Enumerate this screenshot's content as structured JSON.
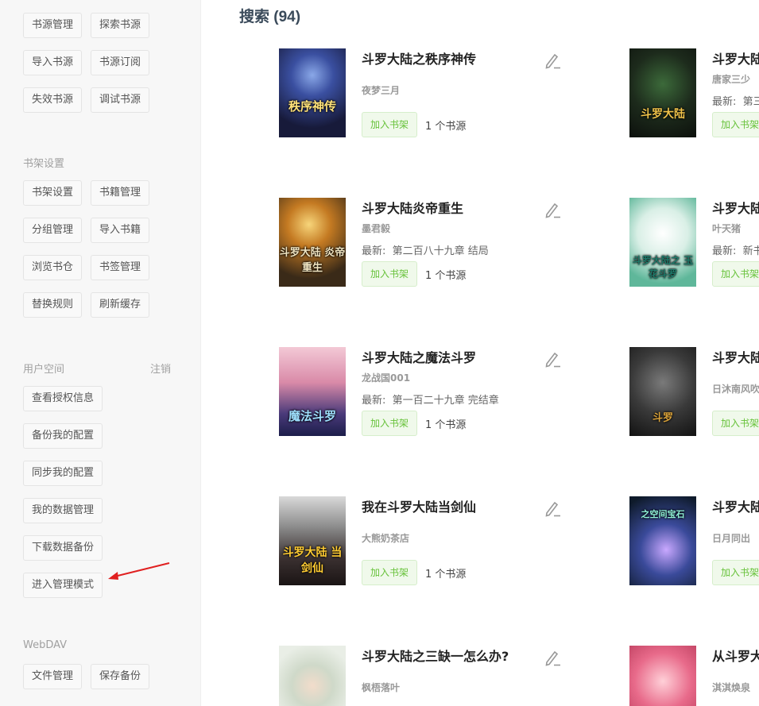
{
  "sidebar": {
    "source_buttons": [
      "书源管理",
      "探索书源",
      "导入书源",
      "书源订阅",
      "失效书源",
      "调试书源"
    ],
    "shelf_section": "书架设置",
    "shelf_buttons": [
      "书架设置",
      "书籍管理",
      "分组管理",
      "导入书籍",
      "浏览书仓",
      "书签管理",
      "替换规则",
      "刷新缓存"
    ],
    "user_section": "用户空间",
    "logout_label": "注销",
    "user_buttons": [
      "查看授权信息",
      "备份我的配置",
      "同步我的配置",
      "我的数据管理",
      "下载数据备份",
      "进入管理模式"
    ],
    "webdav_section": "WebDAV",
    "webdav_buttons": [
      "文件管理",
      "保存备份"
    ]
  },
  "main": {
    "title": "搜索 (94)",
    "add_label": "加入书架",
    "source_label": "1 个书源",
    "latest_prefix": "最新:"
  },
  "books_left": [
    {
      "title": "斗罗大陆之秩序神传",
      "author": "夜梦三月",
      "latest": "",
      "cover_text": "秩序神传"
    },
    {
      "title": "斗罗大陆炎帝重生",
      "author": "墨君毅",
      "latest": "第二百八十九章 结局",
      "cover_text": "斗罗大陆 炎帝重生"
    },
    {
      "title": "斗罗大陆之魔法斗罗",
      "author": "龙战国001",
      "latest": "第一百二十九章 完结章",
      "cover_text": "魔法斗罗"
    },
    {
      "title": "我在斗罗大陆当剑仙",
      "author": "大熊奶茶店",
      "latest": "",
      "cover_text": "斗罗大陆 当剑仙"
    },
    {
      "title": "斗罗大陆之三缺一怎么办?",
      "author": "枫梧落叶",
      "latest": "",
      "cover_text": ""
    }
  ],
  "books_right": [
    {
      "title": "斗罗大陆",
      "author": "唐家三少",
      "latest": "第三",
      "cover_text": "斗罗大陆"
    },
    {
      "title": "斗罗大陆",
      "author": "叶天猪",
      "latest": "新书",
      "cover_text": "斗罗大陆之 玉花斗罗"
    },
    {
      "title": "斗罗大陆",
      "author": "日沐南风吹",
      "latest": "",
      "cover_text": "斗罗"
    },
    {
      "title": "斗罗大陆",
      "author": "日月同出",
      "latest": "",
      "cover_text": "之空间宝石"
    },
    {
      "title": "从斗罗大",
      "author": "淇淇焕泉",
      "latest": "",
      "cover_text": ""
    }
  ],
  "colors": {
    "accent_green": "#67c23a",
    "arrow_red": "#e02020"
  }
}
